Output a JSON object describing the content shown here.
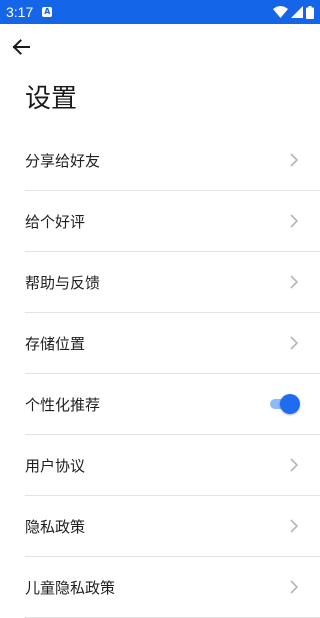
{
  "status_bar": {
    "time": "3:17",
    "notification_glyph": "A",
    "icons": [
      "notification-icon",
      "wifi-icon",
      "signal-icon",
      "battery-icon"
    ],
    "background": "#1565e8"
  },
  "app_bar": {
    "back_icon": "arrow-left-icon"
  },
  "page": {
    "title": "设置"
  },
  "settings": {
    "items": [
      {
        "label": "分享给好友",
        "control": "chevron"
      },
      {
        "label": "给个好评",
        "control": "chevron"
      },
      {
        "label": "帮助与反馈",
        "control": "chevron"
      },
      {
        "label": "存储位置",
        "control": "chevron"
      },
      {
        "label": "个性化推荐",
        "control": "toggle",
        "toggle_on": true
      },
      {
        "label": "用户协议",
        "control": "chevron"
      },
      {
        "label": "隐私政策",
        "control": "chevron"
      },
      {
        "label": "儿童隐私政策",
        "control": "chevron"
      }
    ]
  },
  "colors": {
    "accent": "#1f6cf0",
    "toggle_track": "#8cb9ff",
    "divider": "#e3e3e3"
  }
}
